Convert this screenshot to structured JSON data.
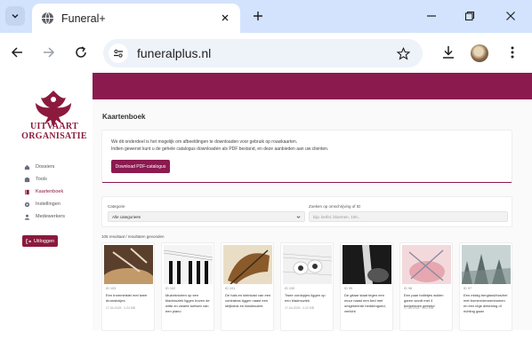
{
  "browser": {
    "tab_title": "Funeral+",
    "url": "funeralplus.nl",
    "icons": [
      "tab-search-icon",
      "globe-icon",
      "close-icon",
      "plus-icon",
      "minimize-icon",
      "restore-icon",
      "close-window-icon",
      "back-icon",
      "forward-icon",
      "reload-icon",
      "site-info-icon",
      "star-icon",
      "download-icon",
      "more-icon"
    ]
  },
  "sidebar": {
    "logo_line1": "UITVAART",
    "logo_line2": "ORGANISATIE",
    "items": [
      {
        "label": "Dossiers",
        "icon": "home-icon",
        "active": false
      },
      {
        "label": "Tools",
        "icon": "box-icon",
        "active": false
      },
      {
        "label": "Kaartenboek",
        "icon": "book-icon",
        "active": true
      },
      {
        "label": "Instellingen",
        "icon": "gear-icon",
        "active": false
      },
      {
        "label": "Medewerkers",
        "icon": "user-icon",
        "active": false
      }
    ],
    "logout_label": "Uitloggen",
    "accent": "#8b1a3d"
  },
  "main": {
    "title": "Kaartenboek",
    "info_line1": "We dit onderdeel is het mogelijk om afbeeldingen te downloaden voor gebruik op rouwkaarten.",
    "info_line2": "Indien gewenst kunt u de gehele catalogus downloaden als PDF bestand, en deze aanbieden aan uw clienten.",
    "pdf_button": "Download PDF-catalogus",
    "category_label": "Categorie",
    "category_value": "Alle categorieën",
    "search_label": "Zoeken op omschrijving of ID",
    "search_placeholder": "bijv. kerfel, bloemen, 100...",
    "results_text": "105 resultaat / resultaten gevonden",
    "cards": [
      {
        "id": "ID 103",
        "desc": "Een trommelstel met twee drumstokjes",
        "meta": "17-04-2025 · 0,24 MB"
      },
      {
        "id": "ID 102",
        "desc": "Muziekmoten op een bladmuziek liggen boven de witte en zwarte toetsen van een piano",
        "meta": ""
      },
      {
        "id": "ID 101",
        "desc": "De hals en kleinkast van een contrabas liggen naast een strijkstok en bladmuziek",
        "meta": ""
      },
      {
        "id": "ID 100",
        "desc": "Twee oordopjes liggen op een bladmuziek",
        "meta": "17-04-2025 · 0,22 MB"
      },
      {
        "id": "ID 99",
        "desc": "De gitaar staat tegen een muur naast een bed met omgekeerde beddengoed, verlicht",
        "meta": ""
      },
      {
        "id": "ID 98",
        "desc": "Een paar bolletjes wollen garen wordt met 4 breipennen gebreid",
        "meta": "17-04-2025 · 0,22 MB"
      },
      {
        "id": "ID 97",
        "desc": "Een mistig bergland/bos/hei met bomen/dennenbomen en een lege dekening of richting gaan",
        "meta": ""
      }
    ]
  },
  "colors": {
    "banner": "#8b1a4f",
    "chrome": "#d3e3fd"
  }
}
